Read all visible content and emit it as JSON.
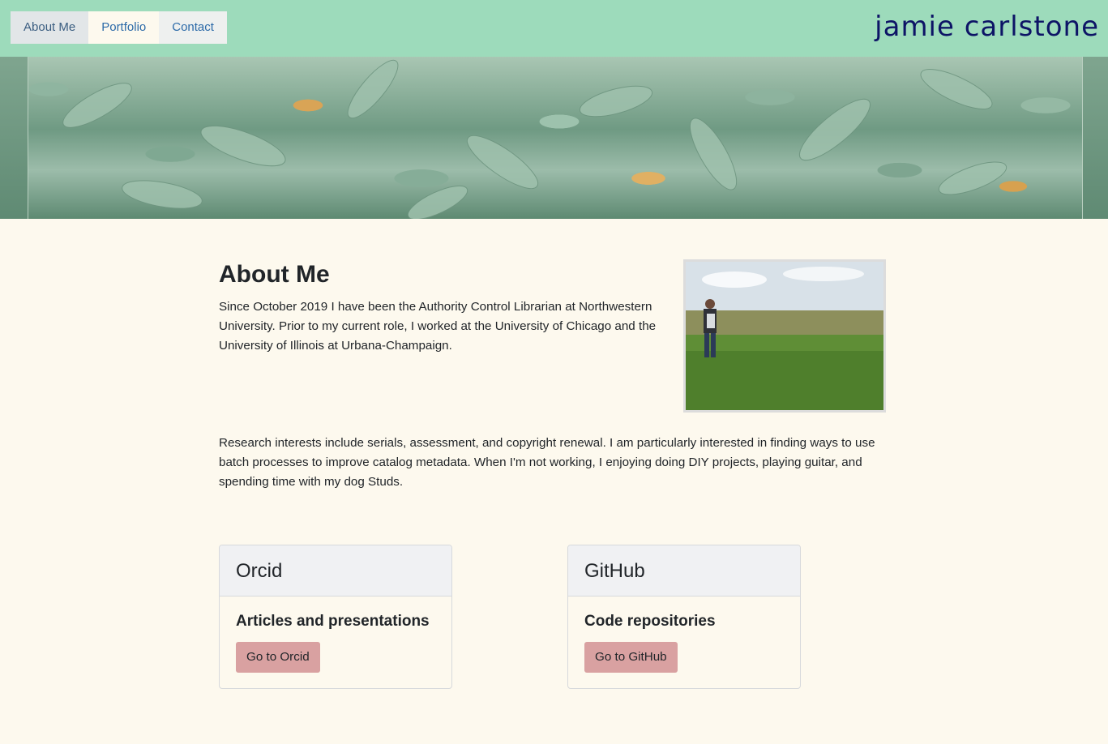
{
  "nav": {
    "items": [
      {
        "label": "About Me"
      },
      {
        "label": "Portfolio"
      },
      {
        "label": "Contact"
      }
    ]
  },
  "site_title": "jamie carlstone",
  "about": {
    "title": "About Me",
    "para1": "Since October 2019 I have been the Authority Control Librarian at Northwestern University. Prior to my current role, I worked at the University of Chicago and the University of Illinois at Urbana-Champaign.",
    "para2": "Research interests include serials, assessment, and copyright renewal. I am particularly interested in finding ways to use batch processes to improve catalog metadata. When I'm not working, I enjoying doing DIY projects, playing guitar, and spending time with my dog Studs."
  },
  "cards": [
    {
      "header": "Orcid",
      "subtitle": "Articles and presentations",
      "button": "Go to Orcid"
    },
    {
      "header": "GitHub",
      "subtitle": "Code repositories",
      "button": "Go to GitHub"
    }
  ],
  "colors": {
    "header_bg": "#9ddbbb",
    "title": "#0d1466",
    "button": "#d9a1a1",
    "page_bg": "#fdf9ee"
  }
}
